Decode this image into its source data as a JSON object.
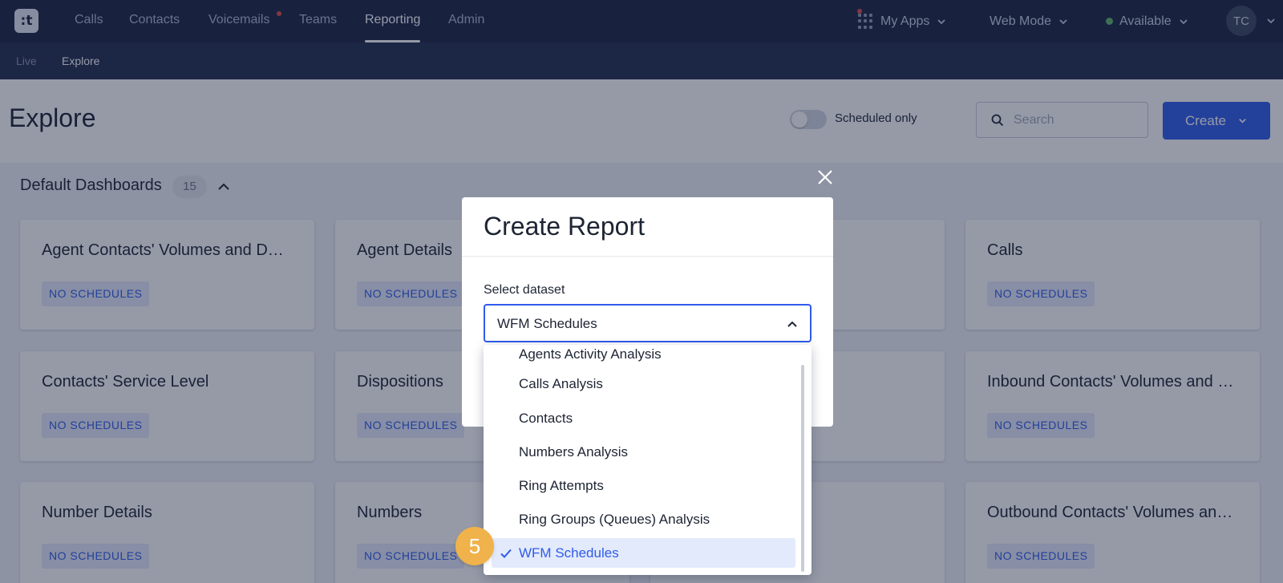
{
  "topnav": {
    "logo": ":t",
    "items": [
      {
        "label": "Calls"
      },
      {
        "label": "Contacts"
      },
      {
        "label": "Voicemails"
      },
      {
        "label": "Teams"
      },
      {
        "label": "Reporting"
      },
      {
        "label": "Admin"
      }
    ],
    "my_apps": "My Apps",
    "mode": "Web Mode",
    "status": "Available",
    "avatar": "TC"
  },
  "subnav": {
    "items": [
      {
        "label": "Live"
      },
      {
        "label": "Explore"
      }
    ]
  },
  "header": {
    "title": "Explore",
    "toggle_label": "Scheduled only",
    "search_placeholder": "Search",
    "create_label": "Create"
  },
  "section": {
    "title": "Default Dashboards",
    "count": "15"
  },
  "cards": [
    {
      "title": "Agent Contacts' Volumes and D…",
      "badge": "NO SCHEDULES"
    },
    {
      "title": "Agent Details",
      "badge": "NO SCHEDULES"
    },
    {
      "title": "",
      "badge": ""
    },
    {
      "title": "Calls",
      "badge": "NO SCHEDULES"
    },
    {
      "title": "Contacts' Service Level",
      "badge": "NO SCHEDULES"
    },
    {
      "title": "Dispositions",
      "badge": "NO SCHEDULES"
    },
    {
      "title": "",
      "badge": ""
    },
    {
      "title": "Inbound Contacts' Volumes and …",
      "badge": "NO SCHEDULES"
    },
    {
      "title": "Number Details",
      "badge": "NO SCHEDULES"
    },
    {
      "title": "Numbers",
      "badge": "NO SCHEDULES"
    },
    {
      "title": "",
      "badge": ""
    },
    {
      "title": "Outbound Contacts' Volumes an…",
      "badge": "NO SCHEDULES"
    }
  ],
  "modal": {
    "title": "Create Report",
    "field_label": "Select dataset",
    "selected_value": "WFM Schedules"
  },
  "dropdown": {
    "options": [
      {
        "label": "Agents Activity Analysis"
      },
      {
        "label": "Calls Analysis"
      },
      {
        "label": "Contacts"
      },
      {
        "label": "Numbers Analysis"
      },
      {
        "label": "Ring Attempts"
      },
      {
        "label": "Ring Groups (Queues) Analysis"
      },
      {
        "label": "WFM Schedules"
      }
    ]
  },
  "step_marker": "5",
  "colors": {
    "nav_bg": "#1b2543",
    "subnav_bg": "#222d4d",
    "accent": "#2f5bea",
    "badge_bg": "#e3eafc",
    "step_marker": "#f0b24a",
    "status_available": "#5db36a"
  },
  "icons": {
    "apps": "grid-icon",
    "search": "search-icon",
    "close": "close-icon",
    "selected": "check-icon"
  }
}
